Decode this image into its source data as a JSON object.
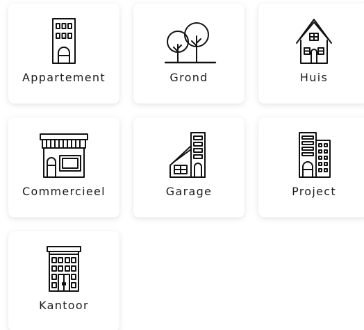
{
  "categories": [
    {
      "label": "Appartement",
      "icon": "apartment-building-icon"
    },
    {
      "label": "Grond",
      "icon": "land-trees-icon"
    },
    {
      "label": "Huis",
      "icon": "house-icon"
    },
    {
      "label": "Commercieel",
      "icon": "shop-storefront-icon"
    },
    {
      "label": "Garage",
      "icon": "garage-building-icon"
    },
    {
      "label": "Project",
      "icon": "project-buildings-icon"
    },
    {
      "label": "Kantoor",
      "icon": "office-building-icon"
    }
  ]
}
